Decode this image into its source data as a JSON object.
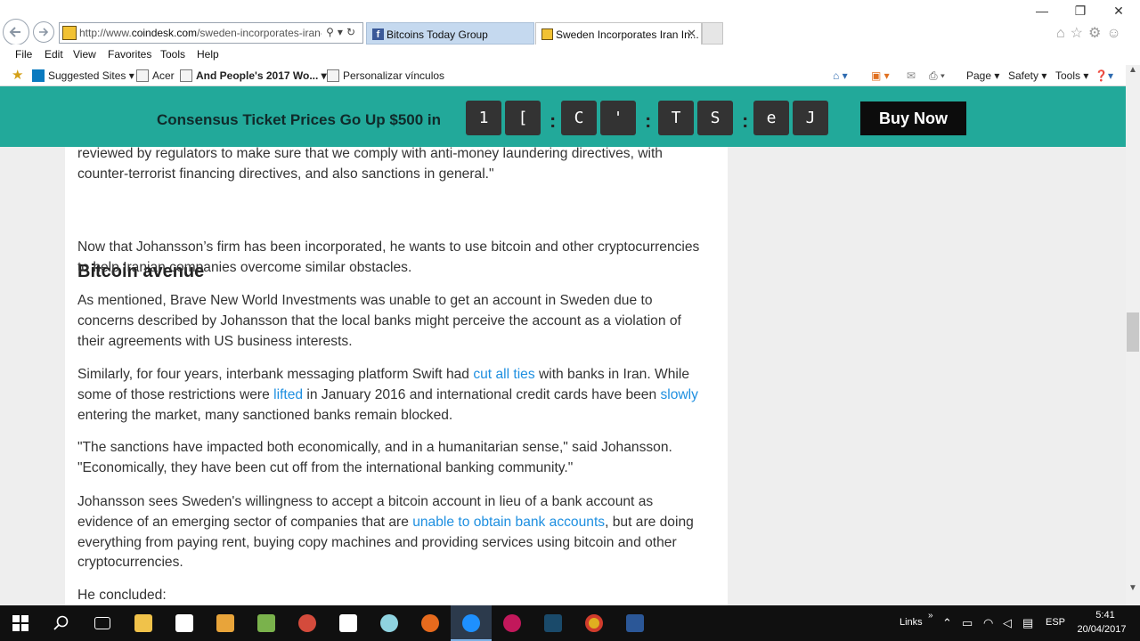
{
  "browser": {
    "address": {
      "prefix": "http://www.",
      "domain": "coindesk.com",
      "path": "/sweden-incorporates-iran-"
    },
    "tabs": [
      {
        "label": "Bitcoins Today Group"
      },
      {
        "label": "Sweden Incorporates Iran In..."
      }
    ],
    "menu": [
      "File",
      "Edit",
      "View",
      "Favorites",
      "Tools",
      "Help"
    ],
    "favorites": [
      "Suggested Sites",
      "Acer",
      "And People's 2017 Wo...",
      "Personalizar vínculos"
    ],
    "commands": [
      "Page",
      "Safety",
      "Tools"
    ]
  },
  "promo": {
    "text": "Consensus Ticket Prices Go Up $500 in",
    "countdown": [
      "1",
      "[",
      "C",
      "'",
      "T",
      "S",
      "e",
      "J"
    ],
    "button": "Buy Now"
  },
  "article": {
    "intro": "reviewed by regulators to make sure that we comply with anti-money laundering directives, with counter-terrorist financing directives, and also sanctions in general.\"",
    "heading": "Bitcoin avenue",
    "p1": "Now that Johansson’s firm has been incorporated, he wants to use bitcoin and other cryptocurrencies to help Iranian companies overcome similar obstacles.",
    "p2": "As mentioned, Brave New World Investments was unable to get an account in Sweden due to concerns described by Johansson that the local banks might perceive the account as a violation of their agreements with US business interests.",
    "p3": {
      "t1": "Similarly, for four years, interbank messaging platform Swift had ",
      "l1": "cut all ties",
      "t2": " with banks in Iran. While some of those restrictions were ",
      "l2": "lifted",
      "t3": " in January 2016 and international credit cards have been ",
      "l3": "slowly",
      "t4": " entering the market, many sanctioned banks remain blocked."
    },
    "p4": "\"The sanctions have impacted both economically, and in a humanitarian sense,\" said Johansson. \"Economically, they have been cut off from the international banking community.\"",
    "p5": {
      "t1": "Johansson sees Sweden's willingness to accept a bitcoin account in lieu of a bank account as evidence of an emerging sector of companies that are ",
      "l1": "unable to obtain bank accounts",
      "t2": ", but are doing everything from paying rent, buying copy machines and providing services using bitcoin and other cryptocurrencies."
    },
    "p6": "He concluded:"
  },
  "taskbar": {
    "links": "Links",
    "lang": "ESP",
    "time": "5:41",
    "date": "20/04/2017"
  },
  "colors": {
    "promo_bg": "#22a99a",
    "link": "#1e8fe0",
    "taskbar": "#101010"
  }
}
